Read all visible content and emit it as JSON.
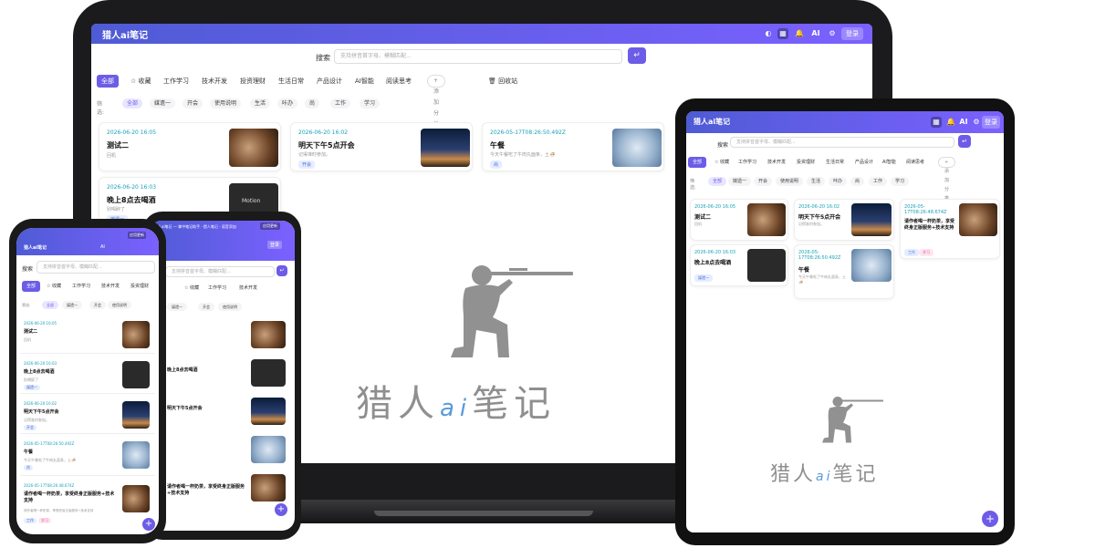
{
  "app": {
    "title": "猎人ai笔记",
    "header_ai": "AI",
    "login": "登录",
    "brand_text_left": "猎人",
    "brand_text_ai": "ai",
    "brand_text_right": "笔记",
    "colors": {
      "primary": "#6c5ce7",
      "header_start": "#4f5bd5",
      "header_end": "#7b61ff",
      "date": "#17a2b8"
    }
  },
  "search": {
    "label": "搜索",
    "placeholder": "支持拼音首字母、模糊匹配..."
  },
  "tabs": [
    "全部",
    "收藏",
    "工作学习",
    "技术开发",
    "投资理财",
    "生活日常",
    "产品设计",
    "AI智能",
    "阅读思考"
  ],
  "add_category": "+ 添加分类",
  "recycle": "回收站",
  "tags_label": "筛选:",
  "tags": [
    "全部",
    "媒遗一",
    "开会",
    "使用说明",
    "生活",
    "咔办",
    "尚",
    "工作",
    "学习"
  ],
  "notes": [
    {
      "date": "2026-06-20 16:05",
      "title": "测试二",
      "desc": "回机",
      "badge": "",
      "thumb": "food"
    },
    {
      "date": "2026-06-20 16:02",
      "title": "明天下午5点开会",
      "desc": "记得准时参加。",
      "badge": "开会",
      "thumb": "night"
    },
    {
      "date": "2026-05-17T08:26:50.492Z",
      "title": "午餐",
      "desc": "今天午餐吃了牛肉丸面条，土🍜",
      "badge": "尚",
      "thumb": "wolf"
    },
    {
      "date": "2026-06-20 16:03",
      "title": "晚上8点去喝酒",
      "desc": "别喝醉了",
      "badge": "媒遗一",
      "thumb": "dark"
    }
  ],
  "extra_note": {
    "date": "2026-05-17T08:26:48.674Z",
    "title": "请作者喝一杯奶茶，享受终身正版服务+技术支持",
    "desc": "请作者喝一杯奶茶，享受终身正版服务+技术支持",
    "badges": [
      "工作",
      "学习"
    ]
  },
  "phone2_banner": "猎人ai笔记 — 掌中笔记助手 · 猎人笔记 · 语音添加",
  "phone2_button": "应用更新",
  "phone_header_right": "应用更新",
  "thumb_dark_text": "Motion",
  "fab": "+"
}
